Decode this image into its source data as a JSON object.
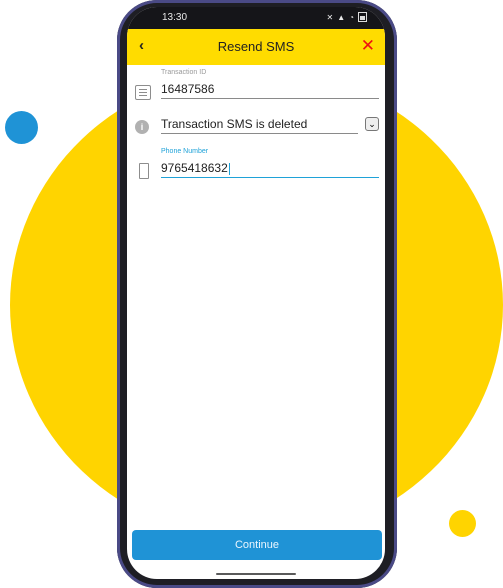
{
  "colors": {
    "yellow": "#ffd400",
    "blue": "#1f93d6",
    "red": "#e11111"
  },
  "status_bar": {
    "time": "13:30",
    "icons": [
      "mute-icon",
      "signal-icon",
      "wifi-icon",
      "battery-icon"
    ]
  },
  "app_bar": {
    "title": "Resend SMS",
    "back_icon": "back-chevron-icon",
    "close_icon": "close-icon"
  },
  "form": {
    "transaction_id": {
      "label": "Transaction ID",
      "value": "16487586",
      "icon": "receipt-icon"
    },
    "reason": {
      "value": "Transaction SMS is deleted",
      "icon": "info-icon",
      "dropdown_icon": "chevron-down-icon"
    },
    "phone": {
      "label": "Phone Number",
      "value": "9765418632",
      "icon": "phone-icon"
    }
  },
  "actions": {
    "continue_label": "Continue"
  }
}
